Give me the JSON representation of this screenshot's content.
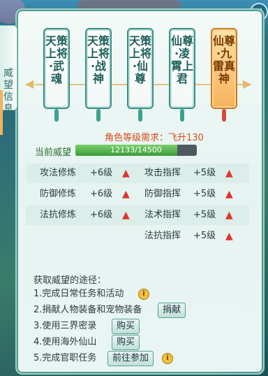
{
  "panel": {
    "side_tab_label": "威望信息",
    "close_glyph": "×"
  },
  "ranks": [
    {
      "label": "天策上将·武魂",
      "active": false
    },
    {
      "label": "天策上将·战神",
      "active": false
    },
    {
      "label": "天策上将·仙尊",
      "active": false
    },
    {
      "label": "仙尊·凌霄上君",
      "active": false
    },
    {
      "label": "仙尊·九雷真神",
      "active": true
    }
  ],
  "requirement": "角色等级需求：飞升130",
  "current": {
    "label": "当前威望",
    "value_text": "12133/14500",
    "value": 12133,
    "max": 14500
  },
  "stats": [
    {
      "left_label": "攻法修炼",
      "left_value": "+6级",
      "right_label": "攻击指挥",
      "right_value": "+5级"
    },
    {
      "left_label": "防御修炼",
      "left_value": "+6级",
      "right_label": "防御指挥",
      "right_value": "+5级"
    },
    {
      "left_label": "法抗修炼",
      "left_value": "+6级",
      "right_label": "法术指挥",
      "right_value": "+5级"
    },
    {
      "left_label": "",
      "left_value": "",
      "right_label": "法抗指挥",
      "right_value": "+5级"
    }
  ],
  "ways": {
    "title": "获取威望的途径：",
    "items": [
      {
        "text": "1.完成日常任务和活动",
        "button": "",
        "info": true
      },
      {
        "text": "2.捐献人物装备和宠物装备",
        "button": "捐献",
        "info": false
      },
      {
        "text": "3.使用三界密录",
        "button": "购买",
        "info": false
      },
      {
        "text": "4.使用海外仙山",
        "button": "购买",
        "info": false
      },
      {
        "text": "5.完成官职任务",
        "button": "前往参加",
        "info": true
      }
    ]
  },
  "colors": {
    "requirement": "#d94a1b",
    "arrow_up": "#e0352b",
    "active_rank": "#f6b25a"
  }
}
